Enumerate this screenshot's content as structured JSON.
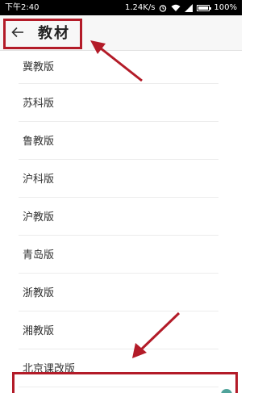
{
  "status_bar": {
    "time": "下午2:40",
    "network_speed": "1.24K/s",
    "battery": "100%",
    "battery_level": 1.0
  },
  "header": {
    "title": "教材",
    "back_icon": "back-arrow-icon"
  },
  "textbooks": [
    "冀教版",
    "苏科版",
    "鲁教版",
    "沪科版",
    "沪教版",
    "青岛版",
    "浙教版",
    "湘教版",
    "北京课改版"
  ],
  "colors": {
    "highlight": "#b31b28",
    "header_bg": "#f7f7f7",
    "status_bg": "#000000"
  }
}
